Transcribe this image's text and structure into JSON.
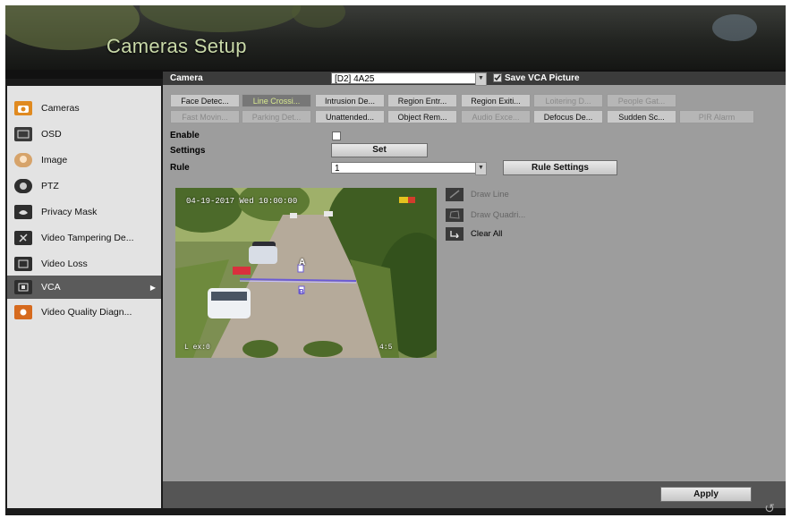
{
  "window": {
    "title": "Cameras Setup"
  },
  "sidebar": {
    "items": [
      {
        "label": "Cameras",
        "icon": "camera-icon"
      },
      {
        "label": "OSD",
        "icon": "osd-icon"
      },
      {
        "label": "Image",
        "icon": "image-icon"
      },
      {
        "label": "PTZ",
        "icon": "ptz-icon"
      },
      {
        "label": "Privacy Mask",
        "icon": "privacy-mask-icon"
      },
      {
        "label": "Video Tampering De...",
        "icon": "video-tampering-icon"
      },
      {
        "label": "Video Loss",
        "icon": "video-loss-icon"
      },
      {
        "label": "VCA",
        "icon": "vca-icon",
        "active": true
      },
      {
        "label": "Video Quality Diagn...",
        "icon": "video-quality-icon"
      }
    ]
  },
  "form": {
    "camera_label": "Camera",
    "camera_value": "[D2] 4A25",
    "save_vca_label": "Save VCA Picture",
    "save_vca_checked": true,
    "enable_label": "Enable",
    "enable_checked": false,
    "settings_label": "Settings",
    "set_button": "Set",
    "rule_label": "Rule",
    "rule_value": "1",
    "rule_settings_button": "Rule Settings"
  },
  "tabs_row1": [
    {
      "label": "Face Detec...",
      "state": "normal"
    },
    {
      "label": "Line Crossi...",
      "state": "selected"
    },
    {
      "label": "Intrusion De...",
      "state": "normal"
    },
    {
      "label": "Region Entr...",
      "state": "normal"
    },
    {
      "label": "Region Exiti...",
      "state": "normal"
    },
    {
      "label": "Loitering D...",
      "state": "dim"
    },
    {
      "label": "People Gat...",
      "state": "dim"
    }
  ],
  "tabs_row2": [
    {
      "label": "Fast Movin...",
      "state": "dim"
    },
    {
      "label": "Parking Det...",
      "state": "dim"
    },
    {
      "label": "Unattended...",
      "state": "normal"
    },
    {
      "label": "Object Rem...",
      "state": "normal"
    },
    {
      "label": "Audio Exce...",
      "state": "dim"
    },
    {
      "label": "Defocus De...",
      "state": "normal"
    },
    {
      "label": "Sudden Sc...",
      "state": "normal"
    },
    {
      "label": "PIR Alarm",
      "state": "dim"
    }
  ],
  "video": {
    "timestamp": "04-19-2017 Wed 10:00:00",
    "corner_bl": "L ex:0",
    "corner_br": "4:5",
    "line_a": "A",
    "line_b": "B"
  },
  "tools": [
    {
      "label": "Draw Line",
      "icon": "draw-line-icon",
      "enabled": false
    },
    {
      "label": "Draw Quadri...",
      "icon": "draw-quadrilateral-icon",
      "enabled": false
    },
    {
      "label": "Clear All",
      "icon": "clear-all-icon",
      "enabled": true
    }
  ],
  "footer": {
    "apply_button": "Apply"
  },
  "colors": {
    "accent": "#d8e98f",
    "title": "#c9d9a8"
  }
}
